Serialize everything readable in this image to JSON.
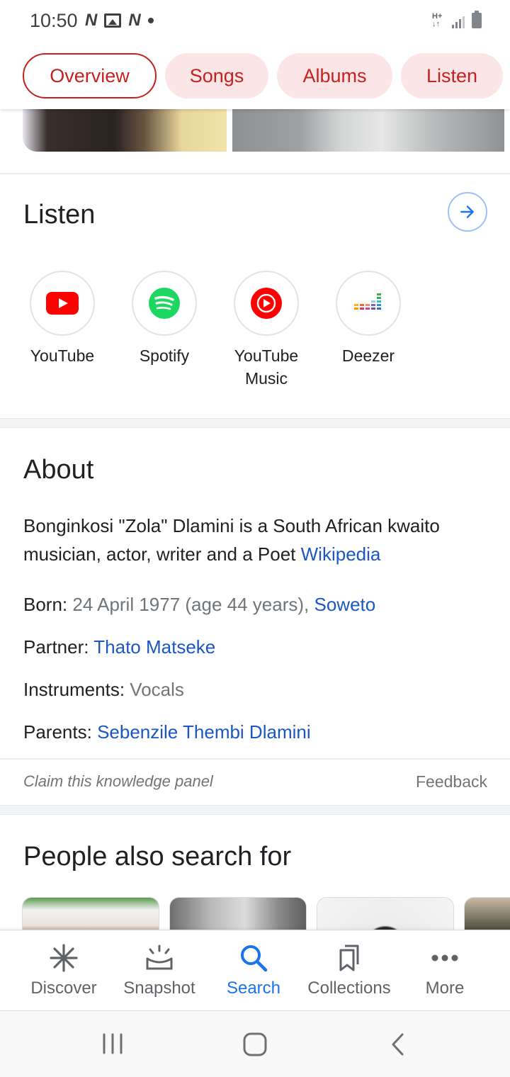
{
  "status_bar": {
    "time": "10:50"
  },
  "chips": [
    "Overview",
    "Songs",
    "Albums",
    "Listen"
  ],
  "listen": {
    "title": "Listen",
    "providers": [
      {
        "label": "YouTube",
        "icon": "youtube-icon"
      },
      {
        "label": "Spotify",
        "icon": "spotify-icon"
      },
      {
        "label": "YouTube Music",
        "icon": "youtube-music-icon"
      },
      {
        "label": "Deezer",
        "icon": "deezer-icon"
      }
    ]
  },
  "about": {
    "title": "About",
    "description": "Bonginkosi \"Zola\" Dlamini is a South African kwaito musician, actor, writer and a Poet",
    "source_link": "Wikipedia",
    "born_label": "Born:",
    "born_value": "24 April 1977 (age 44 years),",
    "born_place": "Soweto",
    "partner_label": "Partner:",
    "partner_value": "Thato Matseke",
    "instruments_label": "Instruments:",
    "instruments_value": "Vocals",
    "parents_label": "Parents:",
    "parents_value": "Sebenzile Thembi Dlamini"
  },
  "footer": {
    "claim": "Claim this knowledge panel",
    "feedback": "Feedback"
  },
  "people": {
    "title": "People also search for"
  },
  "bottom_nav": [
    {
      "label": "Discover",
      "icon": "asterisk-icon"
    },
    {
      "label": "Snapshot",
      "icon": "snapshot-icon"
    },
    {
      "label": "Search",
      "icon": "search-icon"
    },
    {
      "label": "Collections",
      "icon": "collections-icon"
    },
    {
      "label": "More",
      "icon": "more-dots-icon"
    }
  ],
  "colors": {
    "chip_text": "#c5221f",
    "chip_bg": "#fbe5e6",
    "link": "#1a57c2",
    "active_nav": "#1a73e8"
  }
}
